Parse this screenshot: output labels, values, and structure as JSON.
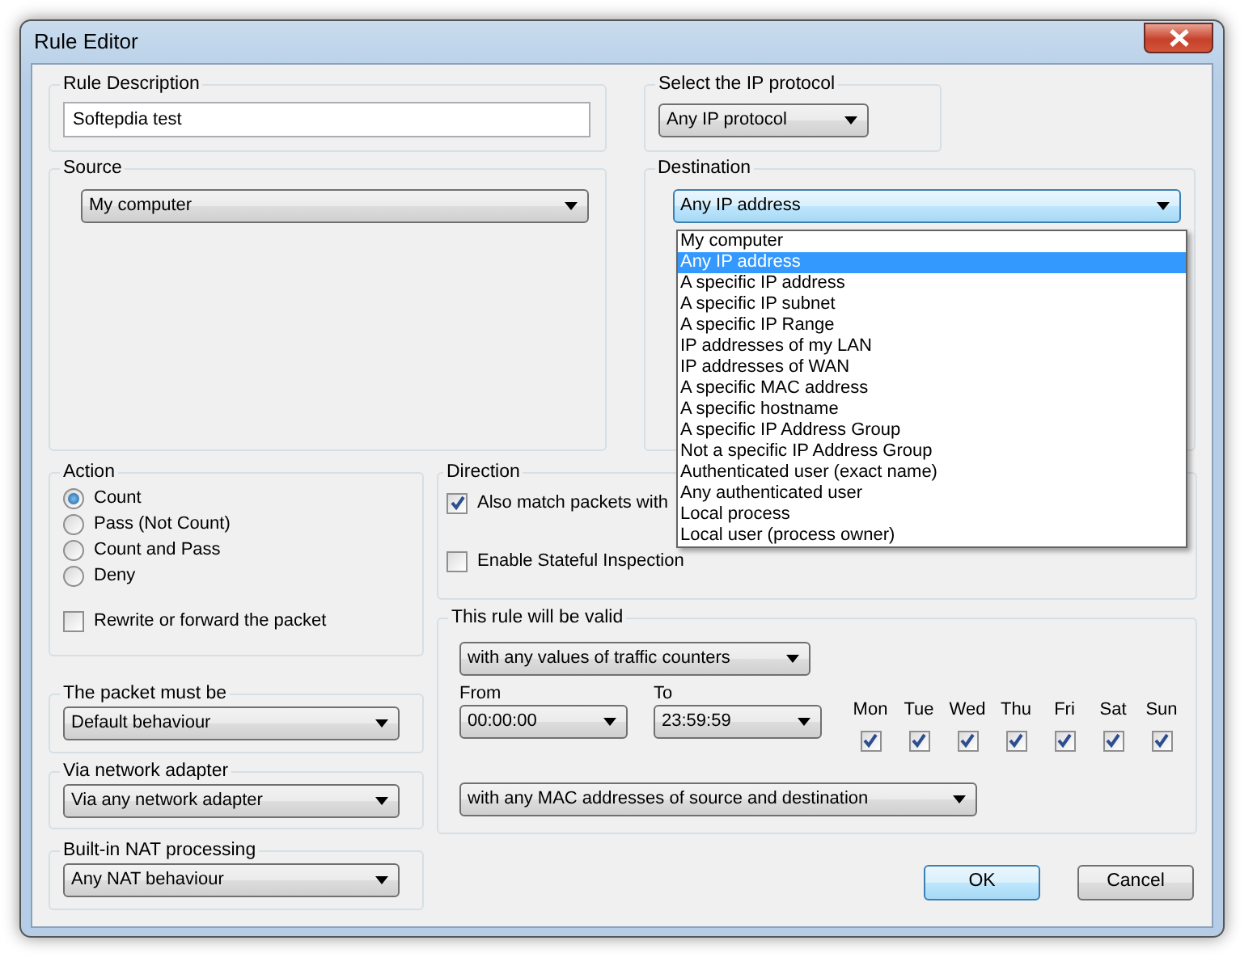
{
  "window": {
    "title": "Rule Editor"
  },
  "rule_description": {
    "label": "Rule Description",
    "value": "Softepdia test"
  },
  "ip_protocol": {
    "label": "Select the IP protocol",
    "value": "Any IP protocol"
  },
  "source": {
    "label": "Source",
    "value": "My computer"
  },
  "destination": {
    "label": "Destination",
    "value": "Any IP address",
    "expanded": true,
    "options": [
      {
        "label": "My computer",
        "selected": false
      },
      {
        "label": "Any IP address",
        "selected": true
      },
      {
        "label": "A specific IP address",
        "selected": false
      },
      {
        "label": "A specific IP subnet",
        "selected": false
      },
      {
        "label": "A specific IP Range",
        "selected": false
      },
      {
        "label": "IP addresses of my LAN",
        "selected": false
      },
      {
        "label": "IP addresses of WAN",
        "selected": false
      },
      {
        "label": "A specific MAC address",
        "selected": false
      },
      {
        "label": "A specific hostname",
        "selected": false
      },
      {
        "label": "A specific IP Address Group",
        "selected": false
      },
      {
        "label": "Not a specific IP Address Group",
        "selected": false
      },
      {
        "label": "Authenticated user (exact name)",
        "selected": false
      },
      {
        "label": "Any authenticated user",
        "selected": false
      },
      {
        "label": "Local process",
        "selected": false
      },
      {
        "label": "Local user (process owner)",
        "selected": false
      }
    ]
  },
  "action": {
    "label": "Action",
    "options": [
      {
        "label": "Count",
        "selected": true
      },
      {
        "label": "Pass (Not Count)",
        "selected": false
      },
      {
        "label": "Count and Pass",
        "selected": false
      },
      {
        "label": "Deny",
        "selected": false
      }
    ],
    "rewrite": {
      "label": "Rewrite or forward the packet",
      "checked": false
    }
  },
  "direction": {
    "label": "Direction",
    "checkboxes": [
      {
        "label": "Also match packets with",
        "checked": true
      },
      {
        "label": "Enable Stateful Inspection",
        "checked": false
      }
    ]
  },
  "packet_must_be": {
    "label": "The packet must be",
    "value": "Default behaviour"
  },
  "network_adapter": {
    "label": "Via network adapter",
    "value": "Via any network adapter"
  },
  "nat": {
    "label": "Built-in NAT processing",
    "value": "Any NAT behaviour"
  },
  "validity": {
    "label": "This rule will be valid",
    "counters": "with any values of traffic counters",
    "from": {
      "label": "From",
      "value": "00:00:00"
    },
    "to": {
      "label": "To",
      "value": "23:59:59"
    },
    "days": [
      {
        "label": "Mon",
        "checked": true
      },
      {
        "label": "Tue",
        "checked": true
      },
      {
        "label": "Wed",
        "checked": true
      },
      {
        "label": "Thu",
        "checked": true
      },
      {
        "label": "Fri",
        "checked": true
      },
      {
        "label": "Sat",
        "checked": true
      },
      {
        "label": "Sun",
        "checked": true
      }
    ],
    "mac": "with any MAC addresses of source and destination"
  },
  "buttons": [
    {
      "label": "OK",
      "default": true
    },
    {
      "label": "Cancel",
      "default": false
    }
  ]
}
